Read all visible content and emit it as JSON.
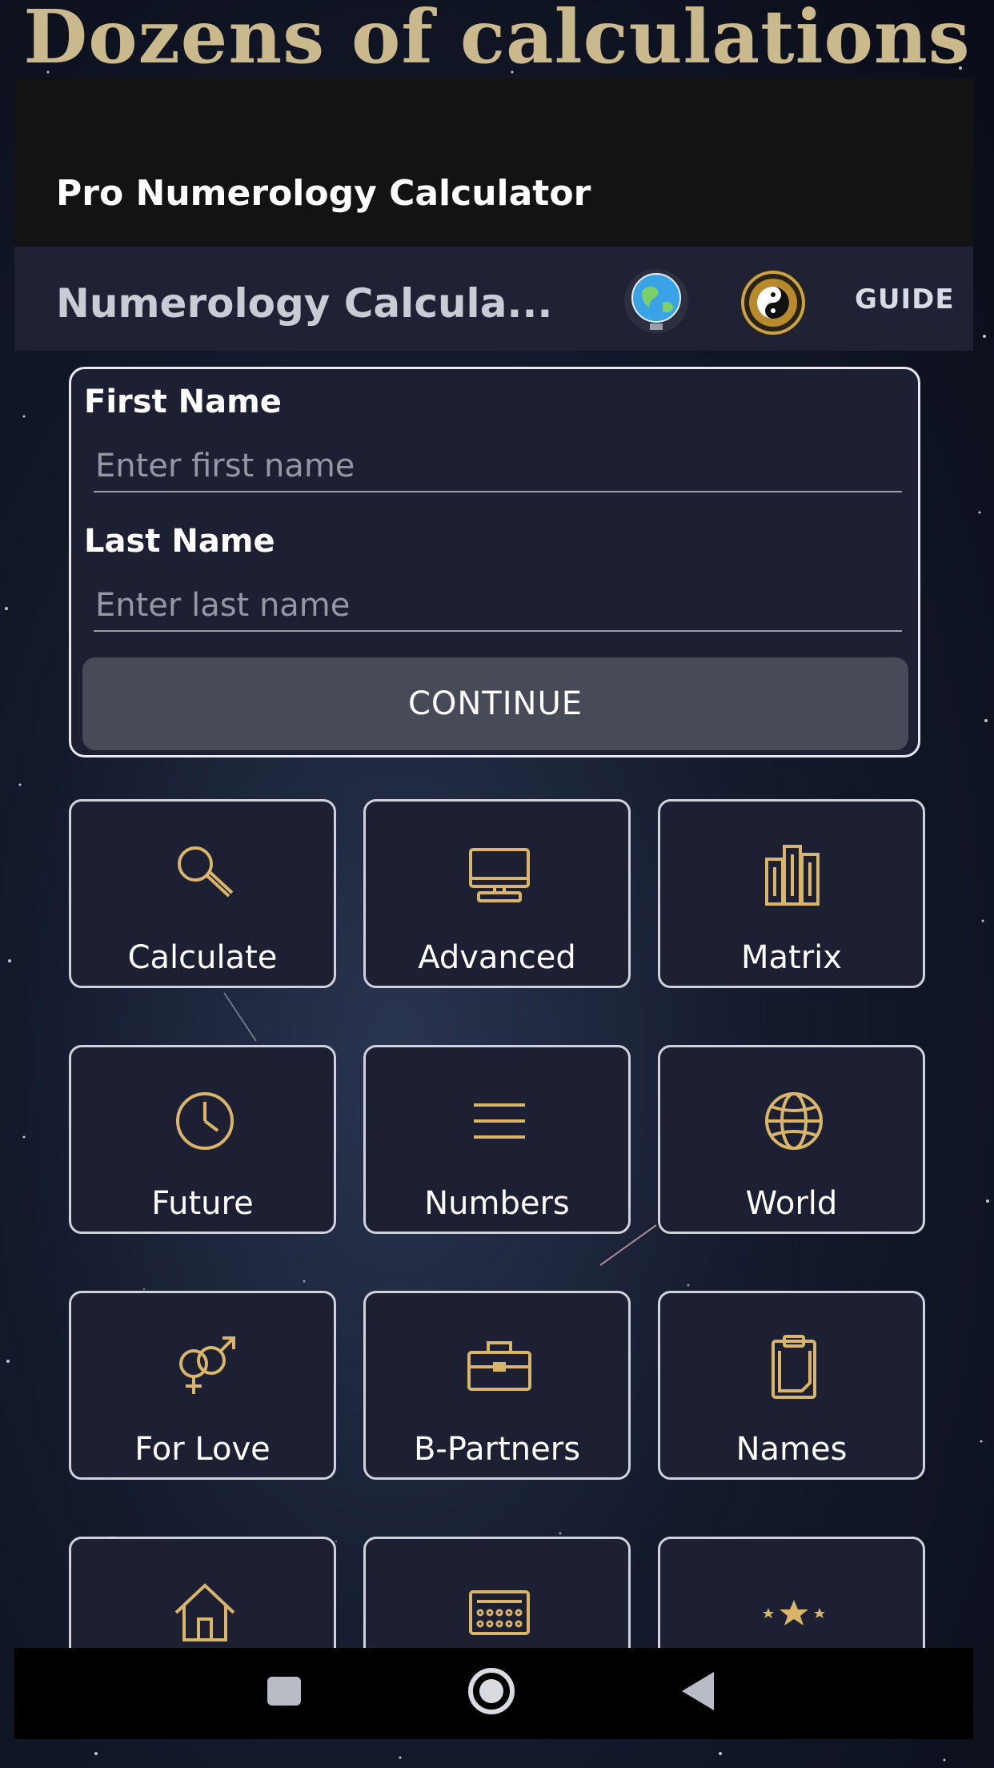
{
  "promo": {
    "title": "Dozens of calculations"
  },
  "app_header": {
    "title": "Pro Numerology Calculator"
  },
  "toolbar": {
    "title": "Numerology Calcula...",
    "guide_label": "GUIDE"
  },
  "form": {
    "first_name_label": "First Name",
    "first_name_placeholder": "Enter first name",
    "first_name_value": "",
    "last_name_label": "Last Name",
    "last_name_placeholder": "Enter last name",
    "last_name_value": "",
    "continue_label": "CONTINUE"
  },
  "tiles": [
    {
      "label": "Calculate",
      "icon": "magnifier-icon"
    },
    {
      "label": "Advanced",
      "icon": "computer-icon"
    },
    {
      "label": "Matrix",
      "icon": "books-icon"
    },
    {
      "label": "Future",
      "icon": "clock-icon"
    },
    {
      "label": "Numbers",
      "icon": "lines-icon"
    },
    {
      "label": "World",
      "icon": "globe-icon"
    },
    {
      "label": "For Love",
      "icon": "gender-symbols-icon"
    },
    {
      "label": "B-Partners",
      "icon": "briefcase-icon"
    },
    {
      "label": "Names",
      "icon": "clipboard-icon"
    },
    {
      "label": "",
      "icon": "house-icon"
    },
    {
      "label": "",
      "icon": "calculator-icon"
    },
    {
      "label": "",
      "icon": "stars-icon"
    }
  ],
  "colors": {
    "accent_gold": "#d8b56a",
    "tile_bg": "#1d2033",
    "toolbar_bg": "#1f2234"
  },
  "navbar": {
    "buttons": [
      "square-icon",
      "home-circle-icon",
      "back-triangle-icon"
    ]
  }
}
